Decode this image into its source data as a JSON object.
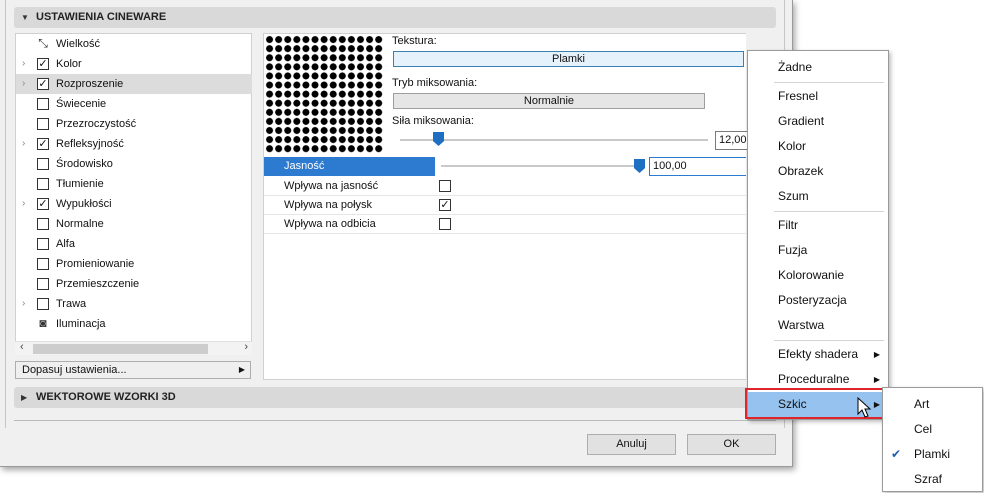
{
  "sections": {
    "cineware_header": "USTAWIENIA CINEWARE",
    "vector_header": "WEKTOROWE WZORKI 3D"
  },
  "channels": [
    {
      "label": "Wielkość",
      "kind": "icon",
      "icon": "resize-icon",
      "expander": false,
      "checked": null
    },
    {
      "label": "Kolor",
      "kind": "check",
      "expander": true,
      "checked": true
    },
    {
      "label": "Rozproszenie",
      "kind": "check",
      "expander": true,
      "checked": true,
      "selected": true
    },
    {
      "label": "Świecenie",
      "kind": "check",
      "expander": false,
      "checked": false
    },
    {
      "label": "Przezroczystość",
      "kind": "check",
      "expander": false,
      "checked": false
    },
    {
      "label": "Refleksyjność",
      "kind": "check",
      "expander": true,
      "checked": true
    },
    {
      "label": "Środowisko",
      "kind": "check",
      "expander": false,
      "checked": false
    },
    {
      "label": "Tłumienie",
      "kind": "check",
      "expander": false,
      "checked": false
    },
    {
      "label": "Wypukłości",
      "kind": "check",
      "expander": true,
      "checked": true
    },
    {
      "label": "Normalne",
      "kind": "check",
      "expander": false,
      "checked": false
    },
    {
      "label": "Alfa",
      "kind": "check",
      "expander": false,
      "checked": false
    },
    {
      "label": "Promieniowanie",
      "kind": "check",
      "expander": false,
      "checked": false
    },
    {
      "label": "Przemieszczenie",
      "kind": "check",
      "expander": false,
      "checked": false
    },
    {
      "label": "Trawa",
      "kind": "check",
      "expander": true,
      "checked": false
    },
    {
      "label": "Iluminacja",
      "kind": "icon",
      "icon": "illumination-icon",
      "expander": false,
      "checked": null
    }
  ],
  "adjust_button": "Dopasuj ustawienia...",
  "texture": {
    "label": "Tekstura:",
    "value": "Plamki",
    "blend_label": "Tryb miksowania:",
    "blend_value": "Normalnie",
    "strength_label": "Siła miksowania:",
    "strength_value": "12,00"
  },
  "properties": {
    "brightness_label": "Jasność",
    "brightness_value": "100,00",
    "rows": [
      {
        "label": "Wpływa na jasność",
        "checked": false
      },
      {
        "label": "Wpływa na połysk",
        "checked": true
      },
      {
        "label": "Wpływa na odbicia",
        "checked": false
      }
    ]
  },
  "buttons": {
    "cancel": "Anuluj",
    "ok": "OK"
  },
  "menu": {
    "groups": [
      [
        "Żadne"
      ],
      [
        "Fresnel",
        "Gradient",
        "Kolor",
        "Obrazek",
        "Szum"
      ],
      [
        "Filtr",
        "Fuzja",
        "Kolorowanie",
        "Posteryzacja",
        "Warstwa"
      ],
      [
        "Efekty shadera",
        "Proceduralne",
        "Szkic"
      ]
    ],
    "submenu_items": [
      "Efekty shadera",
      "Proceduralne",
      "Szkic"
    ],
    "highlighted": "Szkic"
  },
  "submenu": {
    "items": [
      "Art",
      "Cel",
      "Plamki",
      "Szraf"
    ],
    "checked": "Plamki"
  },
  "colors": {
    "selection_blue": "#2d7bd0",
    "menu_highlight": "#95c2ee",
    "callout_red": "#e0242b"
  }
}
